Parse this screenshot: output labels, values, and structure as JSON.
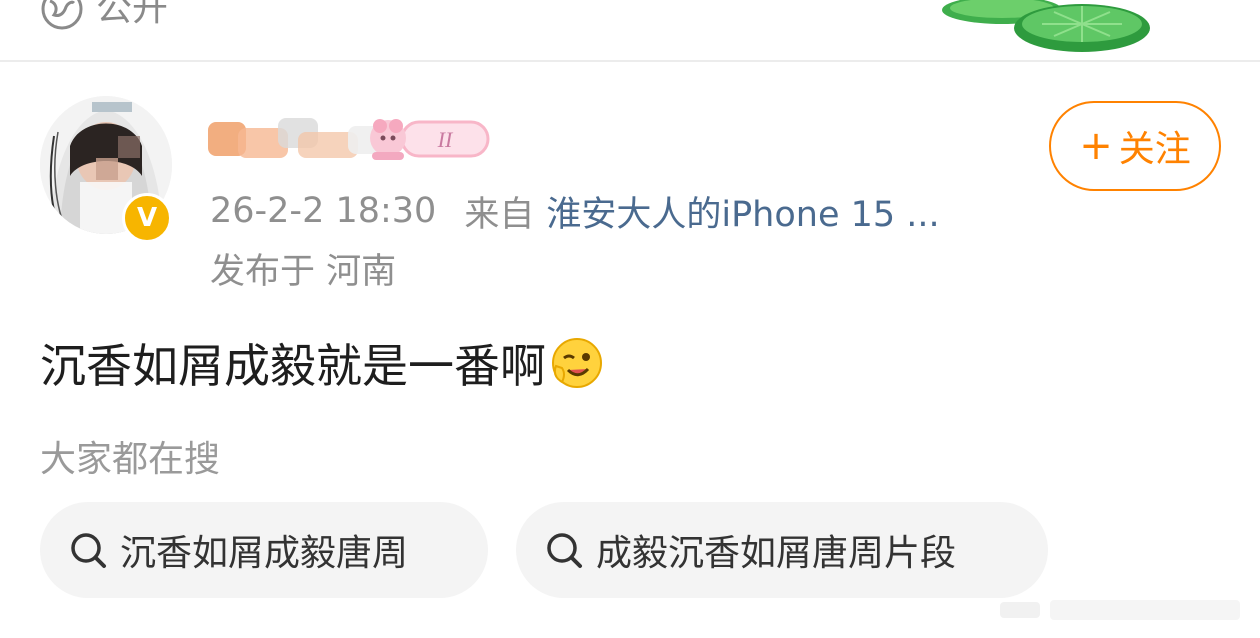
{
  "visibility": {
    "label": "公开",
    "icon": "globe-icon"
  },
  "author": {
    "name_visible": false,
    "verified_badge": "V",
    "follow_label": "关注",
    "follow_icon": "plus-icon"
  },
  "meta": {
    "timestamp": "26-2-2 18:30",
    "source_prefix": "来自",
    "source_device": "淮安大人的iPhone 15 ...",
    "location": "发布于 河南"
  },
  "post": {
    "text": "沉香如屑成毅就是一番啊",
    "emoji": "wink-emoji"
  },
  "search": {
    "heading": "大家都在搜",
    "chips": [
      {
        "label": "沉香如屑成毅唐周",
        "icon": "search-icon"
      },
      {
        "label": "成毅沉香如屑唐周片段",
        "icon": "search-icon"
      }
    ]
  },
  "colors": {
    "accent": "#ff8200",
    "link": "#4a6a8f",
    "muted": "#8f8f8f",
    "text": "#1e1e1e",
    "verified": "#f7b500",
    "chip_bg": "#f4f4f4"
  }
}
